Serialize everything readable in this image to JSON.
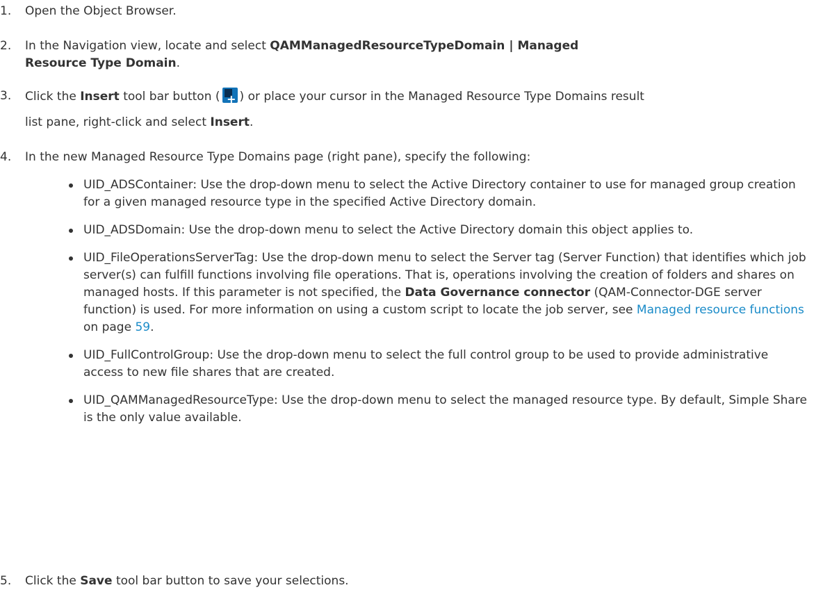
{
  "steps": [
    {
      "num": "1.",
      "text": "Open the Object Browser."
    },
    {
      "num": "2.",
      "pre": "In the Navigation view, locate and select ",
      "bold": "QAMManagedResourceTypeDomain | Managed Resource Type Domain",
      "post": "."
    },
    {
      "num": "3.",
      "pre": "Click the ",
      "bold1": "Insert",
      "mid1": " tool bar button (",
      "icon": "insert-icon",
      "mid2": ") or place your cursor in the Managed Resource Type Domains result",
      "line2_pre": "list pane, right-click and select ",
      "bold2": "Insert",
      "post": "."
    },
    {
      "num": "4.",
      "text": "In the new Managed Resource Type Domains page (right pane), specify the following:"
    },
    {
      "num": "5.",
      "pre": "Click the ",
      "bold": "Save",
      "post": " tool bar button to save your selections."
    }
  ],
  "bullets": [
    {
      "text": "UID_ADSContainer: Use the drop-down menu to select the Active Directory container to use for managed group creation for a given managed resource type in the specified Active Directory domain."
    },
    {
      "text": "UID_ADSDomain: Use the drop-down menu to select the Active Directory domain this object applies to."
    },
    {
      "pre": "UID_FileOperationsServerTag: Use the drop-down menu to select the Server tag (Server Function) that identifies which job server(s) can fulfill functions involving file operations. That is, operations involving the creation of folders and shares on managed hosts. If this parameter is not specified, the ",
      "bold": "Data Governance connector",
      "mid": " (QAM-Connector-DGE server function) is used. For more information on using a custom script to locate the job server, see ",
      "link": "Managed resource functions",
      "mid2": " on page ",
      "page": "59",
      "post": "."
    },
    {
      "text": "UID_FullControlGroup: Use the drop-down menu to select the full control group to be used to provide administrative access to new file shares that are created."
    },
    {
      "text": "UID_QAMManagedResourceType: Use the drop-down menu to select the managed resource type. By default, Simple Share is the only value available."
    }
  ]
}
